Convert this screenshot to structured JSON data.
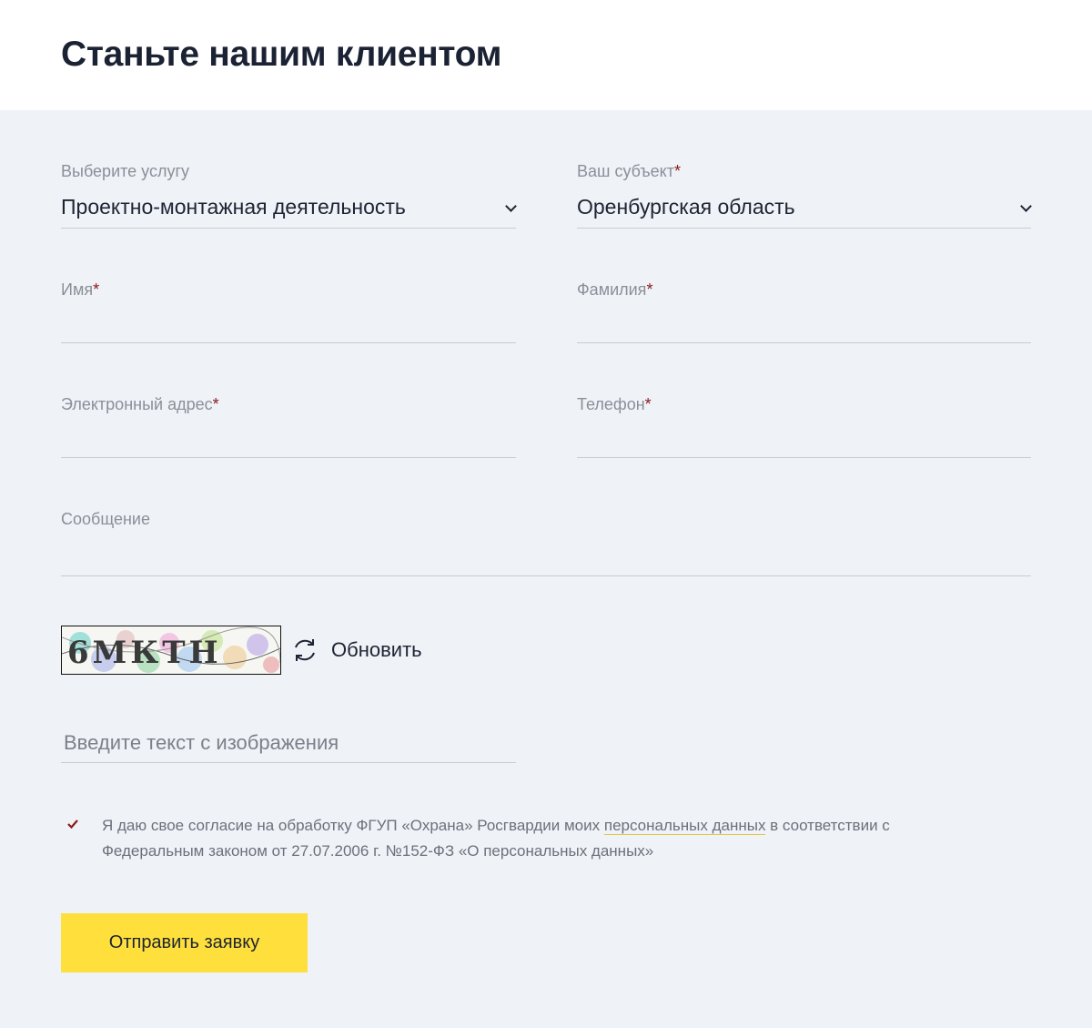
{
  "page": {
    "title": "Станьте нашим клиентом"
  },
  "form": {
    "service": {
      "label": "Выберите услугу",
      "value": "Проектно-монтажная деятельность"
    },
    "region": {
      "label": "Ваш субъект",
      "required_mark": "*",
      "value": "Оренбургская область"
    },
    "first_name": {
      "label": "Имя",
      "required_mark": "*",
      "value": ""
    },
    "last_name": {
      "label": "Фамилия",
      "required_mark": "*",
      "value": ""
    },
    "email": {
      "label": "Электронный адрес",
      "required_mark": "*",
      "value": ""
    },
    "phone": {
      "label": "Телефон",
      "required_mark": "*",
      "value": ""
    },
    "message": {
      "label": "Сообщение",
      "value": ""
    },
    "captcha": {
      "image_text": "6МКТН",
      "refresh_label": "Обновить",
      "input_placeholder": "Введите текст с изображения"
    },
    "consent": {
      "checked": true,
      "text_before": "Я даю свое согласие на обработку ФГУП «Охрана» Росгвардии моих ",
      "link_text": "персональных данных",
      "text_after": " в соответствии с Федеральным законом от 27.07.2006 г. №152-ФЗ «О персональных данных»"
    },
    "submit_label": "Отправить заявку"
  },
  "colors": {
    "background": "#eff2f7",
    "header_background": "#ffffff",
    "accent_button": "#fedf3b",
    "required_mark": "#8a1a1a",
    "check_mark": "#8a1a1a"
  }
}
